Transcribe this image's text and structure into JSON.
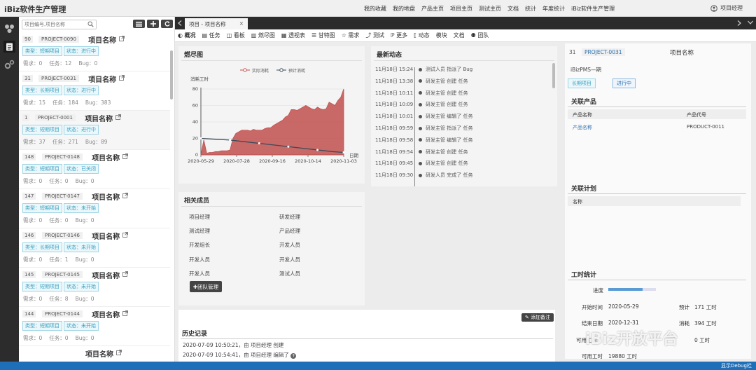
{
  "app": {
    "title": "iBiz软件生产管理"
  },
  "topnav": [
    "我的收藏",
    "我的地盘",
    "产品主页",
    "项目主页",
    "测试主页",
    "文档",
    "统计",
    "年度统计",
    "iBiz软件生产管理"
  ],
  "user": {
    "name": "项目经理"
  },
  "search": {
    "placeholder": "项目编号,项目名称"
  },
  "projects": [
    {
      "no": "90",
      "code": "PROJECT-0090",
      "name": "项目名称",
      "type": "类型：短期项目",
      "status": "状态：进行中",
      "demand": "需求：0",
      "tasks": "任务：12",
      "bugs": "Bug：0"
    },
    {
      "no": "31",
      "code": "PROJECT-0031",
      "name": "项目名称",
      "type": "类型：长期项目",
      "status": "状态：进行中",
      "demand": "需求：15",
      "tasks": "任务：184",
      "bugs": "Bug：383"
    },
    {
      "no": "1",
      "code": "PROJECT-0001",
      "name": "项目名称",
      "type": "类型：短期项目",
      "status": "状态：进行中",
      "demand": "需求：37",
      "tasks": "任务：271",
      "bugs": "Bug：89"
    },
    {
      "no": "148",
      "code": "PROJECT-0148",
      "name": "项目名称",
      "type": "类型：短期项目",
      "status": "状态：已关闭",
      "demand": "需求：0",
      "tasks": "任务：0",
      "bugs": "Bug：0"
    },
    {
      "no": "147",
      "code": "PROJECT-0147",
      "name": "项目名称",
      "type": "类型：短期项目",
      "status": "状态：未开始",
      "demand": "需求：0",
      "tasks": "任务：0",
      "bugs": "Bug：0"
    },
    {
      "no": "146",
      "code": "PROJECT-0146",
      "name": "项目名称",
      "type": "类型：长期项目",
      "status": "状态：未开始",
      "demand": "需求：0",
      "tasks": "任务：1",
      "bugs": "Bug：0"
    },
    {
      "no": "145",
      "code": "PROJECT-0145",
      "name": "项目名称",
      "type": "类型：短期项目",
      "status": "状态：未开始",
      "demand": "需求：0",
      "tasks": "任务：8",
      "bugs": "Bug：0"
    },
    {
      "no": "144",
      "code": "PROJECT-0144",
      "name": "项目名称",
      "type": "类型：短期项目",
      "status": "状态：未开始",
      "demand": "需求：0",
      "tasks": "任务：0",
      "bugs": "Bug：0"
    },
    {
      "no": "",
      "code": "",
      "name": "项目名称",
      "type": "",
      "status": "",
      "demand": "",
      "tasks": "",
      "bugs": ""
    }
  ],
  "tab": {
    "label": "项目 - 项目名称"
  },
  "subnav": [
    "概况",
    "任务",
    "看板",
    "燃尽图",
    "透视表",
    "甘特图",
    "需求",
    "测试",
    "更多",
    "动态",
    "模块",
    "文档",
    "团队"
  ],
  "burndown": {
    "title": "燃尽图"
  },
  "chart_data": {
    "type": "area",
    "title": "",
    "ylabel": "消耗工时",
    "xlabel": "日期",
    "ylim": [
      0,
      80
    ],
    "yticks": [
      0,
      20,
      40,
      60,
      80
    ],
    "xticks": [
      "2020-05-29",
      "2020-07-28",
      "2020-09-16",
      "2020-10-14",
      "2020-11-03"
    ],
    "series": [
      {
        "name": "实际消耗",
        "color": "#c0504d",
        "points": [
          [
            0,
            0
          ],
          [
            2,
            18
          ],
          [
            4,
            2
          ],
          [
            6,
            3
          ],
          [
            8,
            3
          ],
          [
            10,
            4
          ],
          [
            12,
            4
          ],
          [
            14,
            5
          ],
          [
            16,
            5
          ],
          [
            18,
            5
          ],
          [
            20,
            6
          ],
          [
            22,
            20
          ],
          [
            24,
            26
          ],
          [
            26,
            28
          ],
          [
            28,
            30
          ],
          [
            30,
            30
          ],
          [
            32,
            30
          ],
          [
            34,
            29
          ],
          [
            36,
            31
          ],
          [
            38,
            30
          ],
          [
            40,
            30
          ],
          [
            42,
            30
          ],
          [
            44,
            32
          ],
          [
            46,
            33
          ],
          [
            48,
            33
          ],
          [
            50,
            36
          ],
          [
            52,
            38
          ],
          [
            54,
            40
          ],
          [
            56,
            42
          ],
          [
            58,
            46
          ],
          [
            60,
            48
          ],
          [
            62,
            55
          ],
          [
            64,
            55
          ],
          [
            66,
            54
          ],
          [
            68,
            56
          ],
          [
            70,
            58
          ],
          [
            72,
            60
          ],
          [
            74,
            58
          ],
          [
            76,
            56
          ],
          [
            78,
            55
          ],
          [
            80,
            58
          ],
          [
            82,
            56
          ],
          [
            84,
            55
          ],
          [
            86,
            56
          ],
          [
            88,
            64
          ],
          [
            90,
            62
          ],
          [
            92,
            60
          ],
          [
            94,
            66
          ],
          [
            96,
            70
          ],
          [
            98,
            80
          ]
        ]
      },
      {
        "name": "预计消耗",
        "color": "#3b4a5a",
        "points": [
          [
            0,
            20
          ],
          [
            10,
            19
          ],
          [
            20,
            18
          ],
          [
            30,
            16
          ],
          [
            40,
            14
          ],
          [
            50,
            12
          ],
          [
            60,
            10
          ],
          [
            70,
            8
          ],
          [
            80,
            6
          ],
          [
            90,
            4
          ],
          [
            98,
            3
          ]
        ]
      }
    ]
  },
  "feed": {
    "title": "最新动态",
    "rows": [
      [
        "11月18日 15:24",
        "测试人员 指派了 Bug"
      ],
      [
        "11月18日 13:38",
        "研发主管 创建 任务"
      ],
      [
        "11月18日 10:11",
        "研发主管 创建 任务"
      ],
      [
        "11月18日 10:09",
        "研发主管 创建 任务"
      ],
      [
        "11月18日 10:01",
        "研发主管 编辑了 任务"
      ],
      [
        "11月18日 09:59",
        "研发主管 指派了 任务"
      ],
      [
        "11月18日 09:58",
        "研发主管 编辑了 任务"
      ],
      [
        "11月18日 09:54",
        "研发主管 创建 任务"
      ],
      [
        "11月18日 09:45",
        "研发主管 创建 任务"
      ],
      [
        "11月18日 09:30",
        "研发人员 完成了 任务"
      ]
    ]
  },
  "members": {
    "title": "相关成员",
    "items": [
      "项目经理",
      "研发经理",
      "测试经理",
      "产品经理",
      "开发组长",
      "开发人员",
      "开发人员",
      "开发人员",
      "开发人员",
      "测试人员"
    ],
    "button": "团队管理"
  },
  "history": {
    "title": "历史记录",
    "add_note": "添加备注",
    "rows": [
      "2020-07-09 10:50:21，由 项目经理 创建",
      "2020-07-09 10:54:41，由 项目经理 编辑了"
    ]
  },
  "detail": {
    "no": "31",
    "code": "PROJECT-0031",
    "name": "项目名称",
    "product": "iBizPMS—期",
    "type_tag": "长期项目",
    "status_tag": "进行中",
    "related_product": {
      "title": "关联产品",
      "col1": "产品名称",
      "col2": "产品代号",
      "name": "产品名称",
      "code": "PRODUCT-0011"
    },
    "related_plan": {
      "title": "关联计划",
      "col1": "名称"
    },
    "hours": {
      "title": "工时统计",
      "progress_label": "进度",
      "progress": 0.72,
      "start_label": "开始时间",
      "start": "2020-05-29",
      "est_label": "预计",
      "est": "171 工时",
      "end_label": "结束日期",
      "end": "2020-12-31",
      "used_label": "消耗",
      "used": "394 工时",
      "avail_label": "可用工时",
      "avail2": "0 工时",
      "avail": "19880 工时"
    }
  },
  "status_bar": {
    "debug": "显示Debug栏"
  },
  "watermark": "iBiz开放平台"
}
